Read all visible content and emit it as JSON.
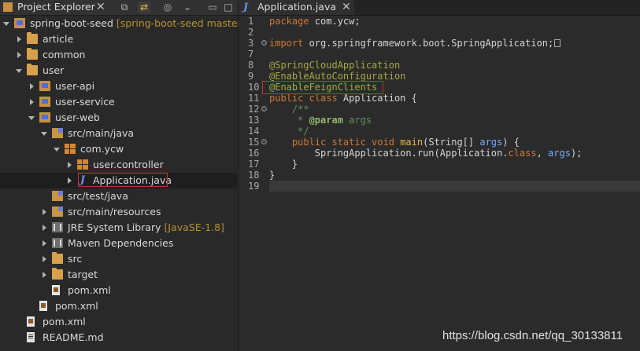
{
  "explorer": {
    "title": "Project Explorer",
    "close_glyph": "✕",
    "toolbar": [
      {
        "icon": "collapse-all-icon",
        "glyph": "⧉",
        "active": false
      },
      {
        "icon": "link-with-editor-icon",
        "glyph": "⇄",
        "active": true
      },
      {
        "icon": "focus-icon",
        "glyph": "◎",
        "active": false
      },
      {
        "icon": "view-menu-icon",
        "glyph": "⌄",
        "active": false
      },
      {
        "icon": "minimize-icon",
        "glyph": "▭",
        "active": false
      },
      {
        "icon": "maximize-icon",
        "glyph": "□",
        "active": false
      }
    ],
    "tree": [
      {
        "label": "spring-boot-seed",
        "decoration": "[spring-boot-seed master]",
        "depth": 0,
        "arrow": "down",
        "icon": "project-icon"
      },
      {
        "label": "article",
        "decoration": "",
        "depth": 1,
        "arrow": "right",
        "icon": "project-folder-icon"
      },
      {
        "label": "common",
        "decoration": "",
        "depth": 1,
        "arrow": "right",
        "icon": "project-folder-icon"
      },
      {
        "label": "user",
        "decoration": "",
        "depth": 1,
        "arrow": "down",
        "icon": "project-folder-icon"
      },
      {
        "label": "user-api",
        "decoration": "",
        "depth": 2,
        "arrow": "right",
        "icon": "maven-project-icon"
      },
      {
        "label": "user-service",
        "decoration": "",
        "depth": 2,
        "arrow": "right",
        "icon": "maven-project-icon"
      },
      {
        "label": "user-web",
        "decoration": "",
        "depth": 2,
        "arrow": "down",
        "icon": "maven-project-icon"
      },
      {
        "label": "src/main/java",
        "decoration": "",
        "depth": 3,
        "arrow": "down",
        "icon": "source-folder-icon"
      },
      {
        "label": "com.ycw",
        "decoration": "",
        "depth": 4,
        "arrow": "down",
        "icon": "package-icon"
      },
      {
        "label": "user.controller",
        "decoration": "",
        "depth": 5,
        "arrow": "right",
        "icon": "package-icon"
      },
      {
        "label": "Application.java",
        "decoration": "",
        "depth": 5,
        "arrow": "right",
        "icon": "java-file-icon",
        "selected": true
      },
      {
        "label": "src/test/java",
        "decoration": "",
        "depth": 3,
        "arrow": "none",
        "icon": "source-folder-icon"
      },
      {
        "label": "src/main/resources",
        "decoration": "",
        "depth": 3,
        "arrow": "right",
        "icon": "source-folder-icon"
      },
      {
        "label": "JRE System Library",
        "decoration": "[JavaSE-1.8]",
        "depth": 3,
        "arrow": "right",
        "icon": "library-icon"
      },
      {
        "label": "Maven Dependencies",
        "decoration": "",
        "depth": 3,
        "arrow": "right",
        "icon": "library-icon"
      },
      {
        "label": "src",
        "decoration": "",
        "depth": 3,
        "arrow": "right",
        "icon": "folder-icon"
      },
      {
        "label": "target",
        "decoration": "",
        "depth": 3,
        "arrow": "right",
        "icon": "folder-icon"
      },
      {
        "label": "pom.xml",
        "decoration": "",
        "depth": 3,
        "arrow": "none",
        "icon": "xml-file-icon"
      },
      {
        "label": "pom.xml",
        "decoration": "",
        "depth": 2,
        "arrow": "none",
        "icon": "xml-file-icon"
      },
      {
        "label": "pom.xml",
        "decoration": "",
        "depth": 1,
        "arrow": "none",
        "icon": "xml-file-icon"
      },
      {
        "label": "README.md",
        "decoration": "",
        "depth": 1,
        "arrow": "none",
        "icon": "markdown-file-icon"
      }
    ]
  },
  "editor": {
    "tab_title": "Application.java",
    "tab_close_glyph": "✕",
    "lines": [
      {
        "num": "1",
        "fold": false,
        "tokens": [
          [
            "kw",
            "package "
          ],
          [
            "typ",
            "com.ycw;"
          ]
        ]
      },
      {
        "num": "2",
        "fold": false,
        "tokens": []
      },
      {
        "num": "3",
        "fold": true,
        "tokens": [
          [
            "kw",
            "import "
          ],
          [
            "typ",
            "org.springframework.boot.SpringApplication;"
          ]
        ],
        "ellipsis": true
      },
      {
        "num": "7",
        "fold": false,
        "tokens": []
      },
      {
        "num": "8",
        "fold": false,
        "tokens": [
          [
            "ann",
            "@SpringCloudApplication"
          ]
        ]
      },
      {
        "num": "9",
        "fold": false,
        "tokens": [
          [
            "ann",
            "@EnableAutoConfiguration"
          ]
        ]
      },
      {
        "num": "10",
        "fold": false,
        "tokens": [
          [
            "ann",
            "@EnableFeignClients"
          ]
        ]
      },
      {
        "num": "11",
        "fold": false,
        "tokens": [
          [
            "kw",
            "public class "
          ],
          [
            "typ",
            "Application {"
          ]
        ]
      },
      {
        "num": "12",
        "fold": true,
        "tokens": [
          [
            "typ",
            "    "
          ],
          [
            "cm",
            "/**"
          ]
        ]
      },
      {
        "num": "13",
        "fold": false,
        "tokens": [
          [
            "typ",
            "     "
          ],
          [
            "cm",
            "* "
          ],
          [
            "cmkw",
            "@param"
          ],
          [
            "cm",
            " args"
          ]
        ]
      },
      {
        "num": "14",
        "fold": false,
        "tokens": [
          [
            "typ",
            "     "
          ],
          [
            "cm",
            "*/"
          ]
        ]
      },
      {
        "num": "15",
        "fold": true,
        "tokens": [
          [
            "typ",
            "    "
          ],
          [
            "kw",
            "public static void "
          ],
          [
            "fn",
            "main"
          ],
          [
            "typ",
            "(String[] "
          ],
          [
            "var",
            "args"
          ],
          [
            "typ",
            ") {"
          ]
        ]
      },
      {
        "num": "16",
        "fold": false,
        "tokens": [
          [
            "typ",
            "        SpringApplication."
          ],
          [
            "typ",
            "run"
          ],
          [
            "typ",
            "(Application."
          ],
          [
            "kw",
            "class"
          ],
          [
            "typ",
            ", "
          ],
          [
            "var",
            "args"
          ],
          [
            "typ",
            ");"
          ]
        ]
      },
      {
        "num": "17",
        "fold": false,
        "tokens": [
          [
            "typ",
            "    }"
          ]
        ]
      },
      {
        "num": "18",
        "fold": false,
        "tokens": [
          [
            "typ",
            "}"
          ]
        ]
      },
      {
        "num": "19",
        "fold": false,
        "tokens": []
      }
    ]
  },
  "watermark": "https://blog.csdn.net/qq_30133811"
}
